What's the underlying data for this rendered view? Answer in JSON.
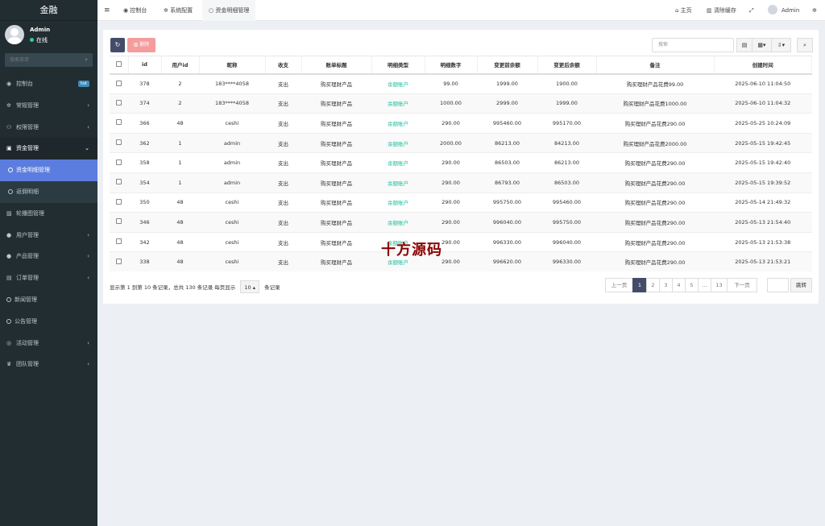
{
  "app": {
    "title": "金融"
  },
  "user": {
    "name": "Admin",
    "status": "在线"
  },
  "sidebar": {
    "search_placeholder": "搜索菜单",
    "items": [
      {
        "label": "控制台",
        "badge": "hot"
      },
      {
        "label": "常规管理"
      },
      {
        "label": "权限管理"
      },
      {
        "label": "资金管理",
        "open": true
      },
      {
        "label": "资金明细管理",
        "sub": true,
        "active": true
      },
      {
        "label": "返佣明细",
        "sub": true
      },
      {
        "label": "轮播图管理"
      },
      {
        "label": "用户管理"
      },
      {
        "label": "产品管理"
      },
      {
        "label": "订单管理"
      },
      {
        "label": "新闻管理"
      },
      {
        "label": "公告管理"
      },
      {
        "label": "活动管理"
      },
      {
        "label": "团队管理"
      }
    ]
  },
  "topbar": {
    "tabs": [
      "控制台",
      "系统配置",
      "资金明细管理"
    ],
    "home": "主页",
    "clear_cache": "清除缓存",
    "user": "Admin"
  },
  "toolbar": {
    "delete": "删除",
    "search_placeholder": "搜索"
  },
  "table": {
    "headers": [
      "id",
      "用户id",
      "昵称",
      "收支",
      "账单标题",
      "明细类型",
      "明细数字",
      "变更前余额",
      "变更后余额",
      "备注",
      "创建时间"
    ],
    "rows": [
      [
        "378",
        "2",
        "183****4058",
        "支出",
        "购买理财产品",
        "余额账户",
        "99.00",
        "1999.00",
        "1900.00",
        "购买理财产品花费99.00",
        "2025-06-10 11:04:50"
      ],
      [
        "374",
        "2",
        "183****4058",
        "支出",
        "购买理财产品",
        "余额账户",
        "1000.00",
        "2999.00",
        "1999.00",
        "购买理财产品花费1000.00",
        "2025-06-10 11:04:32"
      ],
      [
        "366",
        "48",
        "ceshi",
        "支出",
        "购买理财产品",
        "余额账户",
        "290.00",
        "995460.00",
        "995170.00",
        "购买理财产品花费290.00",
        "2025-05-25 10:24:09"
      ],
      [
        "362",
        "1",
        "admin",
        "支出",
        "购买理财产品",
        "余额账户",
        "2000.00",
        "86213.00",
        "84213.00",
        "购买理财产品花费2000.00",
        "2025-05-15 19:42:45"
      ],
      [
        "358",
        "1",
        "admin",
        "支出",
        "购买理财产品",
        "余额账户",
        "290.00",
        "86503.00",
        "86213.00",
        "购买理财产品花费290.00",
        "2025-05-15 19:42:40"
      ],
      [
        "354",
        "1",
        "admin",
        "支出",
        "购买理财产品",
        "余额账户",
        "290.00",
        "86793.00",
        "86503.00",
        "购买理财产品花费290.00",
        "2025-05-15 19:39:52"
      ],
      [
        "350",
        "48",
        "ceshi",
        "支出",
        "购买理财产品",
        "余额账户",
        "290.00",
        "995750.00",
        "995460.00",
        "购买理财产品花费290.00",
        "2025-05-14 21:49:32"
      ],
      [
        "346",
        "48",
        "ceshi",
        "支出",
        "购买理财产品",
        "余额账户",
        "290.00",
        "996040.00",
        "995750.00",
        "购买理财产品花费290.00",
        "2025-05-13 21:54:40"
      ],
      [
        "342",
        "48",
        "ceshi",
        "支出",
        "购买理财产品",
        "余额账户",
        "290.00",
        "996330.00",
        "996040.00",
        "购买理财产品花费290.00",
        "2025-05-13 21:53:38"
      ],
      [
        "338",
        "48",
        "ceshi",
        "支出",
        "购买理财产品",
        "余额账户",
        "290.00",
        "996620.00",
        "996330.00",
        "购买理财产品花费290.00",
        "2025-05-13 21:53:21"
      ]
    ]
  },
  "footer": {
    "info_prefix": "显示第 1 到第 10 条记录，总共 130 条记录 每页显示",
    "page_size": "10",
    "info_suffix": "条记录",
    "prev": "上一页",
    "pages": [
      "1",
      "2",
      "3",
      "4",
      "5",
      "...",
      "13"
    ],
    "next": "下一页",
    "jump": "跳转"
  },
  "watermark": "十方源码"
}
